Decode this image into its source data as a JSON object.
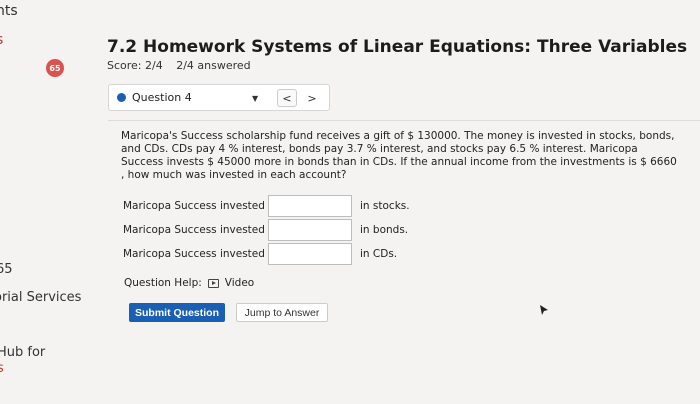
{
  "sidebar": {
    "frag1": "nts",
    "frag2": "s",
    "frag3": "65",
    "frag4": "orial Services",
    "frag5": "Hub for",
    "frag6": "s"
  },
  "header": {
    "badge": "65",
    "title": "7.2 Homework Systems of Linear Equations: Three Variables",
    "score": "Score: 2/4",
    "answered": "2/4 answered"
  },
  "question_nav": {
    "selected": "Question 4",
    "prev": "<",
    "next": ">"
  },
  "problem": {
    "text": "Maricopa's Success scholarship fund receives a gift of $ 130000. The money is invested in stocks, bonds, and CDs. CDs pay 4 % interest, bonds pay 3.7 % interest, and stocks pay 6.5 % interest. Maricopa Success invests $ 45000 more in bonds than in CDs. If the annual income from the investments is $ 6660 , how much was invested in each account?"
  },
  "answers": [
    {
      "label": "Maricopa Success invested $",
      "value": "",
      "unit": "in stocks."
    },
    {
      "label": "Maricopa Success invested $",
      "value": "",
      "unit": "in bonds."
    },
    {
      "label": "Maricopa Success invested $",
      "value": "",
      "unit": "in CDs."
    }
  ],
  "help": {
    "label": "Question Help:",
    "video": "Video"
  },
  "buttons": {
    "submit": "Submit Question",
    "jump": "Jump to Answer"
  }
}
